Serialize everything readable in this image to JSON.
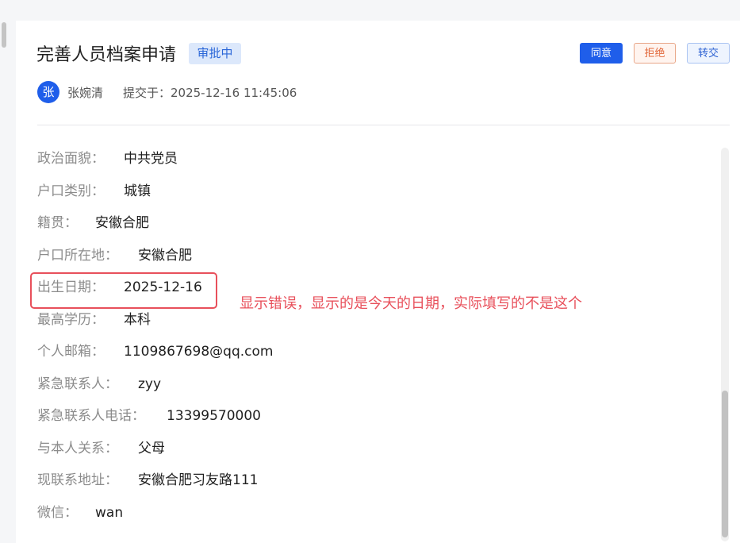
{
  "header": {
    "title": "完善人员档案申请",
    "status_badge": "审批中",
    "actions": {
      "approve": "同意",
      "reject": "拒绝",
      "transfer": "转交"
    }
  },
  "applicant": {
    "avatar_char": "张",
    "name": "张婉清",
    "submitted": "提交于：2025-12-16 11:45:06"
  },
  "fields": [
    {
      "label": "政治面貌：",
      "value": "中共党员"
    },
    {
      "label": "户口类别：",
      "value": "城镇"
    },
    {
      "label": "籍贯：",
      "value": "安徽合肥"
    },
    {
      "label": "户口所在地：",
      "value": "安徽合肥"
    },
    {
      "label": "出生日期：",
      "value": "2025-12-16"
    },
    {
      "label": "最高学历：",
      "value": "本科"
    },
    {
      "label": "个人邮箱：",
      "value": "1109867698@qq.com"
    },
    {
      "label": "紧急联系人：",
      "value": "zyy"
    },
    {
      "label": "紧急联系人电话：",
      "value": "13399570000"
    },
    {
      "label": "与本人关系：",
      "value": "父母"
    },
    {
      "label": "现联系地址：",
      "value": "安徽合肥习友路111"
    },
    {
      "label": "微信：",
      "value": "wan"
    }
  ],
  "annotation": {
    "note": "显示错误，显示的是今天的日期，实际填写的不是这个",
    "color": "#e8505b"
  },
  "colors": {
    "primary": "#1f5eea",
    "reject": "#e2683b",
    "label": "#8c8c8c"
  }
}
